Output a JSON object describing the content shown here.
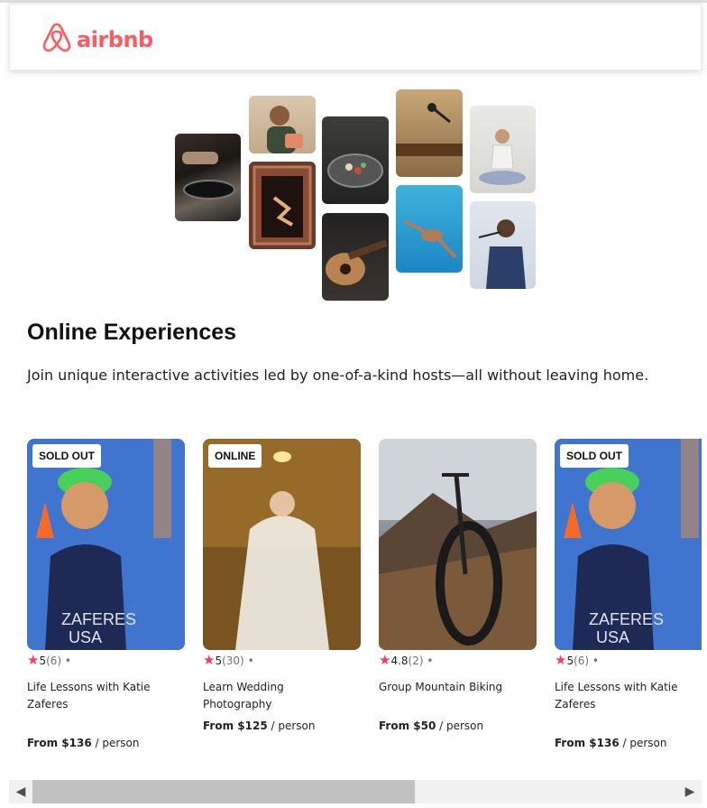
{
  "header": {
    "logo_text": "airbnb"
  },
  "collage": {
    "images": [
      {
        "name": "cooking-pan-image"
      },
      {
        "name": "pottery-woman-image"
      },
      {
        "name": "dancer-doorway-image"
      },
      {
        "name": "food-bowl-image"
      },
      {
        "name": "guitar-image"
      },
      {
        "name": "singer-microphone-image"
      },
      {
        "name": "swimmer-pool-image"
      },
      {
        "name": "yoga-woman-image"
      },
      {
        "name": "performer-singing-image"
      }
    ]
  },
  "section": {
    "title": "Online Experiences",
    "subtitle": "Join unique interactive activities led by one-of-a-kind hosts—all without leaving home."
  },
  "cards": [
    {
      "badge": "SOLD OUT",
      "rating": "5",
      "count": "(6)",
      "dot": "•",
      "title": "Life Lessons with Katie Zaferes",
      "price_prefix": "From $136",
      "price_suffix": " / person"
    },
    {
      "badge": "ONLINE",
      "rating": "5",
      "count": "(30)",
      "dot": "•",
      "title": "Learn Wedding Photography",
      "price_prefix": "From $125",
      "price_suffix": " / person"
    },
    {
      "badge": "",
      "rating": "4.8",
      "count": "(2)",
      "dot": "•",
      "title": "Group Mountain Biking",
      "price_prefix": "From $50",
      "price_suffix": " / person"
    },
    {
      "badge": "SOLD OUT",
      "rating": "5",
      "count": "(6)",
      "dot": "•",
      "title": "Life Lessons with Katie Zaferes",
      "price_prefix": "From $136",
      "price_suffix": " / person"
    }
  ],
  "scrollbar": {
    "left_arrow": "◀",
    "right_arrow": "▶",
    "thumb_fraction": 0.55
  },
  "colors": {
    "brand": "#ff5a5f",
    "star": "#ff385c"
  },
  "icons": {
    "logo": "airbnb-belo-icon",
    "star": "star-icon"
  }
}
